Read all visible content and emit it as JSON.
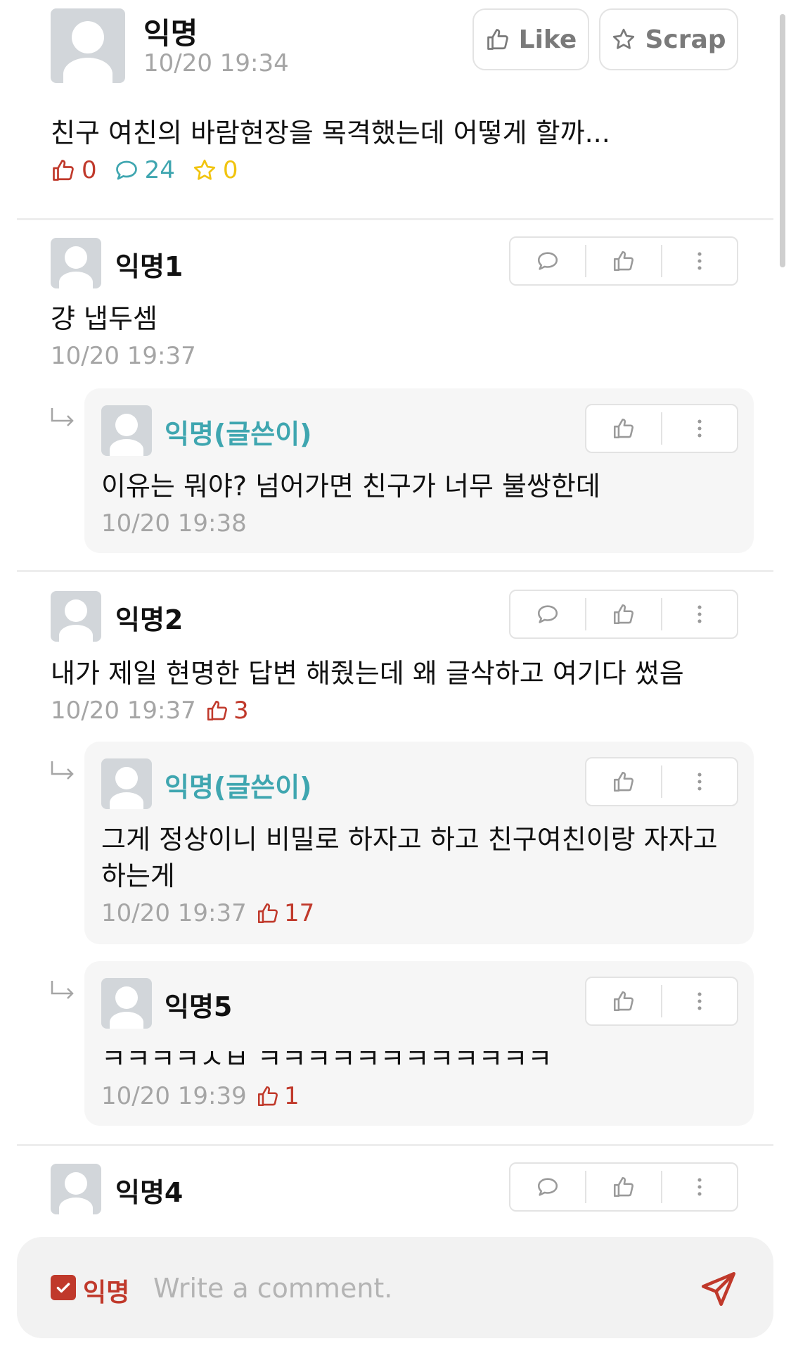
{
  "post": {
    "author": "익명",
    "time": "10/20 19:34",
    "like_button": "Like",
    "scrap_button": "Scrap",
    "content": "친구 여친의 바람현장을 목격했는데 어떻게 할까...",
    "likes": "0",
    "comments": "24",
    "scraps": "0"
  },
  "comments": [
    {
      "author": "익명1",
      "text": "걍 냅두셈",
      "time": "10/20 19:37"
    },
    {
      "author": "익명(글쓴이)",
      "text": "이유는 뭐야? 넘어가면 친구가 너무 불쌍한데",
      "time": "10/20 19:38"
    },
    {
      "author": "익명2",
      "text": "내가 제일 현명한 답변 해줬는데 왜 글삭하고 여기다 썼음",
      "time": "10/20 19:37",
      "likes": "3"
    },
    {
      "author": "익명(글쓴이)",
      "text_line1": "그게 정상이니 비밀로 하자고 하고 친구여친이랑 자자고",
      "text_line2": "하는게",
      "time": "10/20 19:37",
      "likes": "17"
    },
    {
      "author": "익명5",
      "text": "ㅋㅋㅋㅋㅅㅂ ㅋㅋㅋㅋㅋㅋㅋㅋㅋㅋㅋㅋ",
      "time": "10/20 19:39",
      "likes": "1"
    },
    {
      "author": "익명4"
    }
  ],
  "composer": {
    "anon_label": "익명",
    "anon_checked": true,
    "placeholder": "Write a comment."
  },
  "colors": {
    "accent_red": "#c0392b",
    "author_teal": "#3fa6b0",
    "comment_teal": "#3fa6b0",
    "scrap_yellow": "#f1c40f"
  }
}
